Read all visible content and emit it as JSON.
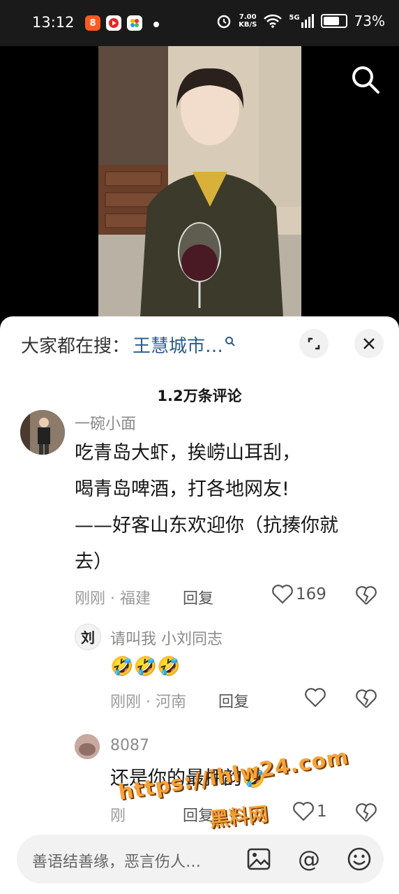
{
  "status_bar": {
    "time": "13:12",
    "net_speed_value": "7.00",
    "net_speed_unit": "KB/S",
    "network": "5G",
    "battery": "73%",
    "app_badges": [
      "app-red-icon",
      "video-play-icon",
      "colorful-app-icon"
    ]
  },
  "video": {
    "search_icon": "search-icon"
  },
  "sheet": {
    "hot_search_label": "大家都在搜：",
    "hot_search_term": "王慧城市…",
    "expand_icon": "expand-icon",
    "close_icon": "close-icon",
    "comment_count": "1.2万条评论"
  },
  "comments": [
    {
      "user": "一碗小面",
      "lines": [
        "吃青岛大虾，挨崂山耳刮，",
        "喝青岛啤酒，打各地网友!",
        "——好客山东欢迎你（抗揍你就",
        "去）"
      ],
      "time_location": "刚刚 · 福建",
      "reply_label": "回复",
      "likes": "169"
    },
    {
      "user": "请叫我  小刘同志",
      "text": "🤣🤣🤣",
      "time_location": "刚刚 · 河南",
      "reply_label": "回复",
      "likes": ""
    },
    {
      "user": "8087",
      "text": "还是你的最押韵🤣",
      "time_location": "刚",
      "reply_label": "回复",
      "likes": "1"
    }
  ],
  "input": {
    "placeholder": "善语结善缘，恶言伤人…"
  },
  "watermark": {
    "url": "https://ihlw24.com",
    "name": "黑料网"
  },
  "colors": {
    "link": "#2b5b8d",
    "watermark": "#f4a23b"
  }
}
